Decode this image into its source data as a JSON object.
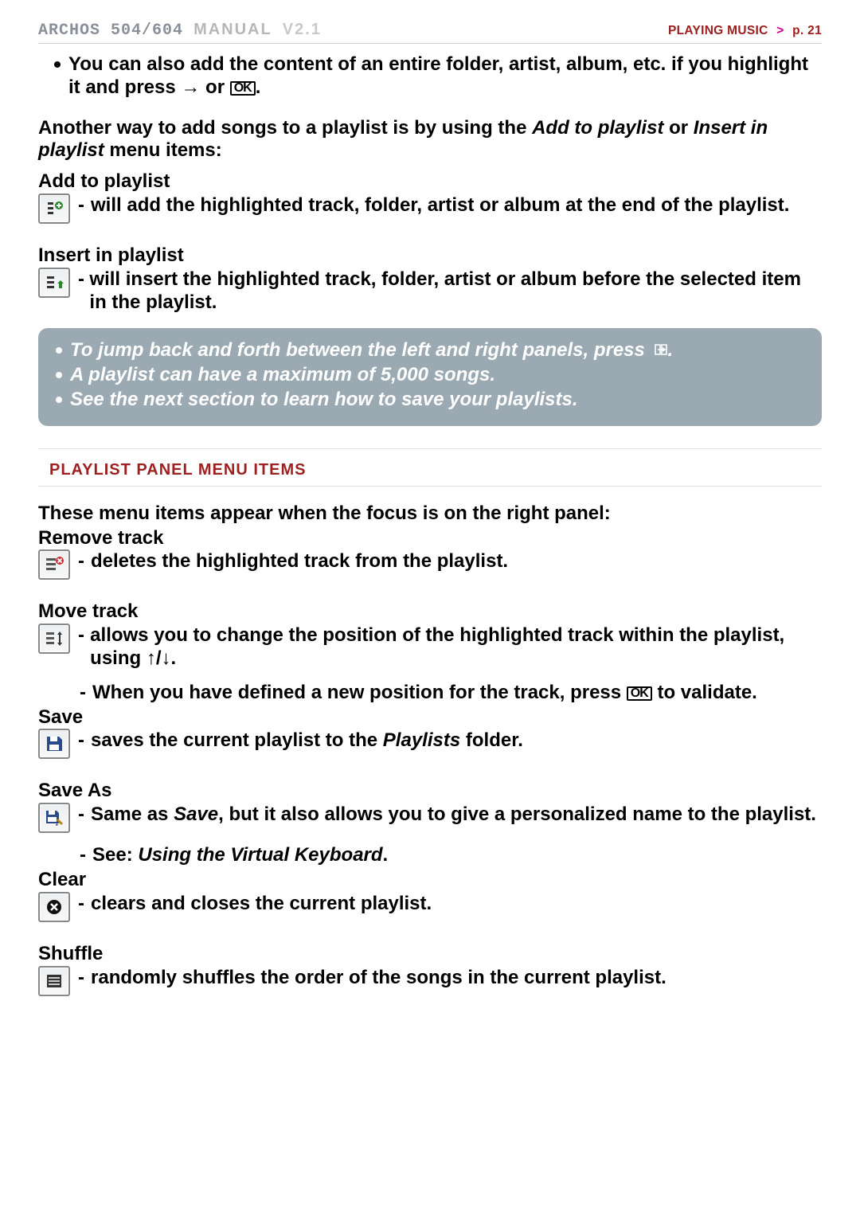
{
  "header": {
    "brand_archos": "ARCHOS",
    "brand_model": "504/604",
    "brand_manual": "MANUAL",
    "brand_version": "V2.1",
    "crumb_section": "PLAYING MUSIC",
    "crumb_arrow": ">",
    "crumb_page": "p. 21"
  },
  "intro_bullet": {
    "text_a": "You can also add the content of an entire folder, artist, album, etc. if you highlight it and press ",
    "arrow": "→",
    "or": " or ",
    "ok": "OK",
    "period": "."
  },
  "para1": {
    "text_a": "Another way to add songs to a playlist is by using the ",
    "add_em": "Add to playlist",
    "text_b": " or ",
    "insert_em": "Insert in playlist",
    "text_c": " menu items:"
  },
  "add": {
    "title": "Add to playlist",
    "desc": "will add the highlighted track, folder, artist or album at the end of the playlist."
  },
  "insert": {
    "title": "Insert in playlist",
    "desc": "will insert the highlighted track, folder, artist or album before the selected item in the playlist."
  },
  "info": {
    "l1a": "To jump back and forth between the left and right panels, press ",
    "l1_sym": "↻",
    "l1b": ".",
    "l2": "A playlist can have a maximum of 5,000 songs.",
    "l3": "See the next section to learn how to save your playlists."
  },
  "section_title": "PLAYLIST PANEL MENU ITEMS",
  "panel_intro": "These menu items appear when the focus is on the right panel:",
  "remove": {
    "title": "Remove track",
    "desc": "deletes the highlighted track from the playlist."
  },
  "move": {
    "title": "Move track",
    "d1a": "allows you to change the position of the highlighted track within the playlist, using ",
    "d1_sym": "↑/↓",
    "d1b": ".",
    "d2a": "When you have defined a new position for the track, press ",
    "d2_ok": "OK",
    "d2b": " to validate."
  },
  "save": {
    "title": "Save",
    "d1a": "saves the current playlist to the ",
    "d1_em": "Playlists",
    "d1b": " folder."
  },
  "saveas": {
    "title": "Save As",
    "d1a": "Same as ",
    "d1_em": "Save",
    "d1b": ", but it also allows you to give a personalized name to the playlist.",
    "d2a": "See: ",
    "d2_em": "Using the Virtual Keyboard",
    "d2b": "."
  },
  "clear": {
    "title": "Clear",
    "desc": "clears and closes the current playlist."
  },
  "shuffle": {
    "title": "Shuffle",
    "desc": "randomly shuffles the order of the songs in the current playlist."
  }
}
